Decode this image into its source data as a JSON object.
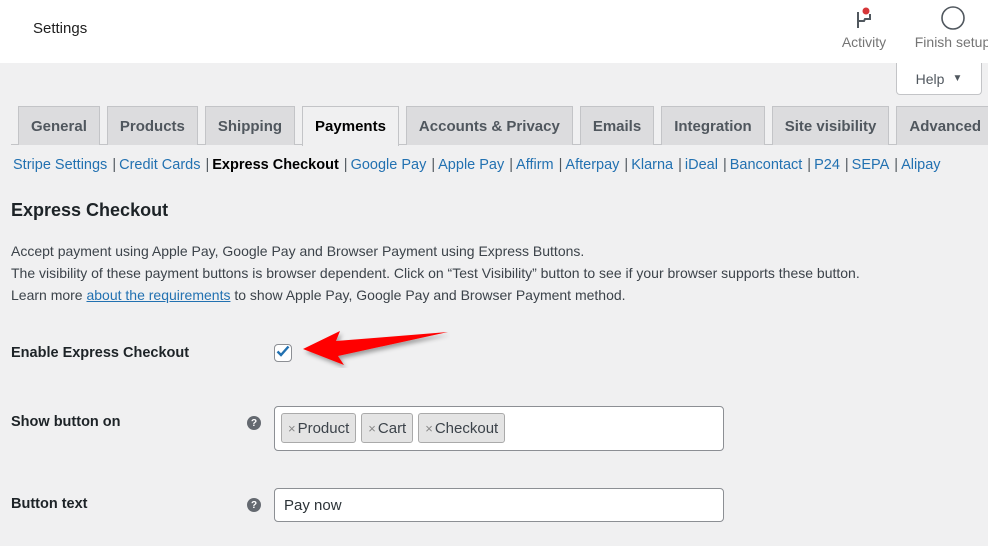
{
  "header": {
    "title": "Settings",
    "activity_label": "Activity",
    "finish_setup_label": "Finish setup",
    "activity_icon": "flag-icon",
    "finish_setup_icon": "circle-progress-icon",
    "notification_color": "#d63638"
  },
  "help": {
    "label": "Help",
    "caret": "▼"
  },
  "tabs": [
    {
      "label": "General",
      "active": false
    },
    {
      "label": "Products",
      "active": false
    },
    {
      "label": "Shipping",
      "active": false
    },
    {
      "label": "Payments",
      "active": true
    },
    {
      "label": "Accounts & Privacy",
      "active": false
    },
    {
      "label": "Emails",
      "active": false
    },
    {
      "label": "Integration",
      "active": false
    },
    {
      "label": "Site visibility",
      "active": false
    },
    {
      "label": "Advanced",
      "active": false
    }
  ],
  "subnav": {
    "separator": "|",
    "items": [
      {
        "label": "Stripe Settings",
        "current": false
      },
      {
        "label": "Credit Cards",
        "current": false
      },
      {
        "label": "Express Checkout",
        "current": true
      },
      {
        "label": "Google Pay",
        "current": false
      },
      {
        "label": "Apple Pay",
        "current": false
      },
      {
        "label": "Affirm",
        "current": false
      },
      {
        "label": "Afterpay",
        "current": false
      },
      {
        "label": "Klarna",
        "current": false
      },
      {
        "label": "iDeal",
        "current": false
      },
      {
        "label": "Bancontact",
        "current": false
      },
      {
        "label": "P24",
        "current": false
      },
      {
        "label": "SEPA",
        "current": false
      },
      {
        "label": "Alipay",
        "current": false
      }
    ]
  },
  "section": {
    "title": "Express Checkout",
    "desc_line1": "Accept payment using Apple Pay, Google Pay and Browser Payment using Express Buttons.",
    "desc_line2": "The visibility of these payment buttons is browser dependent. Click on “Test Visibility” button to see if your browser supports these button.",
    "desc_line3_prefix": "Learn more ",
    "desc_line3_link": "about the requirements",
    "desc_line3_suffix": " to show Apple Pay, Google Pay and Browser Payment method."
  },
  "fields": {
    "enable": {
      "label": "Enable Express Checkout",
      "checked": true
    },
    "show_on": {
      "label": "Show button on",
      "help": "?",
      "tags": [
        {
          "remove": "×",
          "label": "Product"
        },
        {
          "remove": "×",
          "label": "Cart"
        },
        {
          "remove": "×",
          "label": "Checkout"
        }
      ]
    },
    "button_text": {
      "label": "Button text",
      "help": "?",
      "value": "Pay now"
    }
  },
  "colors": {
    "link": "#2271b1",
    "annotation_arrow": "#ff0000"
  }
}
